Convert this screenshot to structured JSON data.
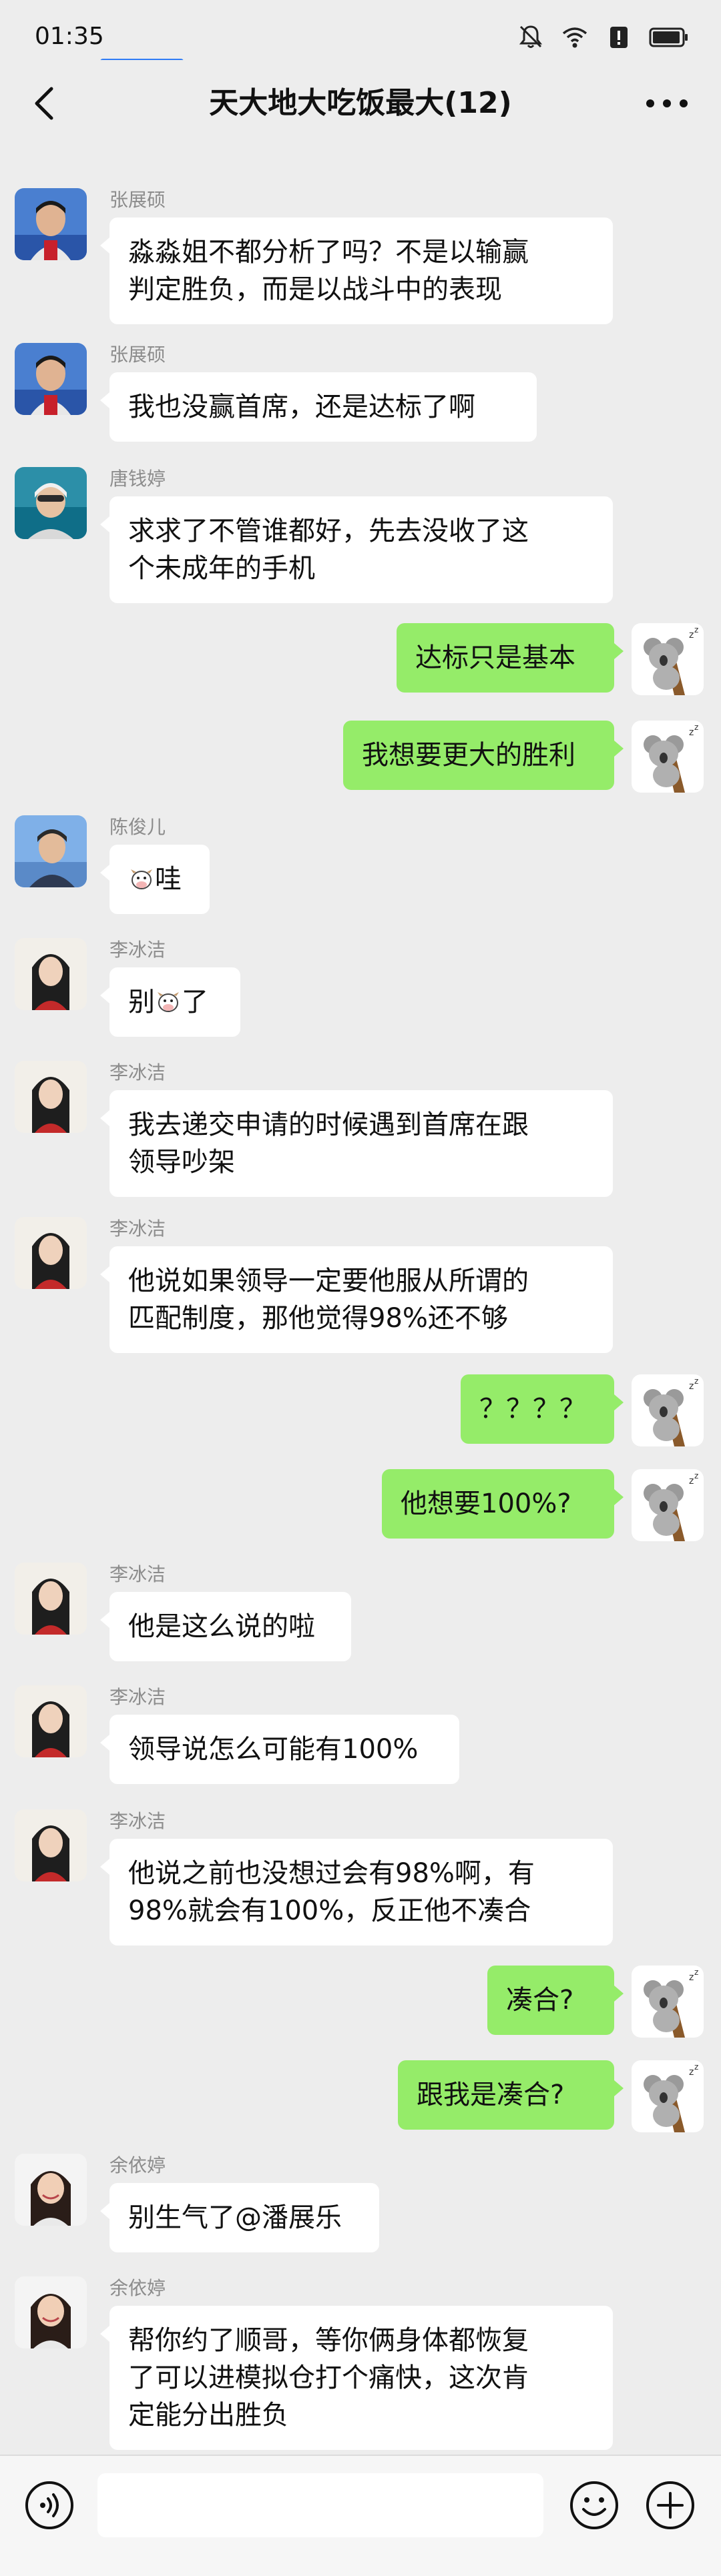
{
  "status_bar": {
    "time": "01:35",
    "icons": [
      "mute-bell-icon",
      "wifi-icon",
      "alert-icon",
      "battery-icon"
    ]
  },
  "header": {
    "title": "天大地大吃饭最大(12)",
    "back_icon": "chevron-left-icon",
    "more_icon": "more-dots-icon"
  },
  "colors": {
    "background": "#ededed",
    "self_bubble": "#95ec69",
    "other_bubble": "#ffffff",
    "sender_name": "#8c8c8c",
    "status_indicator": "#2f7cf6"
  },
  "messages": [
    {
      "side": "left",
      "sender": "张展硕",
      "avatar": "zhang-zhanshuo-avatar",
      "lines": [
        "淼淼姐不都分析了吗？不是以输赢",
        "判定胜负，而是以战斗中的表现"
      ]
    },
    {
      "side": "left",
      "sender": "张展硕",
      "avatar": "zhang-zhanshuo-avatar",
      "lines": [
        "我也没赢首席，还是达标了啊"
      ]
    },
    {
      "side": "left",
      "sender": "唐钱婷",
      "avatar": "tang-qianting-avatar",
      "lines": [
        "求求了不管谁都好，先去没收了这",
        "个未成年的手机"
      ]
    },
    {
      "side": "right",
      "avatar": "koala-avatar",
      "lines": [
        "达标只是基本"
      ]
    },
    {
      "side": "right",
      "avatar": "koala-avatar",
      "lines": [
        "我想要更大的胜利"
      ]
    },
    {
      "side": "left",
      "sender": "陈俊儿",
      "avatar": "chen-juner-avatar",
      "lines": [
        "哇"
      ],
      "cow_emoji": "prefix"
    },
    {
      "side": "left",
      "sender": "李冰洁",
      "avatar": "li-bingjie-avatar",
      "lines": [
        "别",
        "了"
      ],
      "cow_emoji": "middle"
    },
    {
      "side": "left",
      "sender": "李冰洁",
      "avatar": "li-bingjie-avatar",
      "lines": [
        "我去递交申请的时候遇到首席在跟",
        "领导吵架"
      ]
    },
    {
      "side": "left",
      "sender": "李冰洁",
      "avatar": "li-bingjie-avatar",
      "lines": [
        "他说如果领导一定要他服从所谓的",
        "匹配制度，那他觉得98%还不够"
      ]
    },
    {
      "side": "right",
      "avatar": "koala-avatar",
      "lines": [
        "？？？？"
      ]
    },
    {
      "side": "right",
      "avatar": "koala-avatar",
      "lines": [
        "他想要100%?"
      ]
    },
    {
      "side": "left",
      "sender": "李冰洁",
      "avatar": "li-bingjie-avatar",
      "lines": [
        "他是这么说的啦"
      ]
    },
    {
      "side": "left",
      "sender": "李冰洁",
      "avatar": "li-bingjie-avatar",
      "lines": [
        "领导说怎么可能有100%"
      ]
    },
    {
      "side": "left",
      "sender": "李冰洁",
      "avatar": "li-bingjie-avatar",
      "lines": [
        "他说之前也没想过会有98%啊，有",
        "98%就会有100%，反正他不凑合"
      ]
    },
    {
      "side": "right",
      "avatar": "koala-avatar",
      "lines": [
        "凑合?"
      ]
    },
    {
      "side": "right",
      "avatar": "koala-avatar",
      "lines": [
        "跟我是凑合?"
      ]
    },
    {
      "side": "left",
      "sender": "余依婷",
      "avatar": "yu-yiting-avatar",
      "lines": [
        "别生气了@潘展乐"
      ]
    },
    {
      "side": "left",
      "sender": "余依婷",
      "avatar": "yu-yiting-avatar",
      "lines": [
        "帮你约了顺哥，等你俩身体都恢复",
        "了可以进模拟仓打个痛快，这次肯",
        "定能分出胜负"
      ]
    }
  ],
  "input_bar": {
    "voice_icon": "voice-icon",
    "emoji_icon": "emoji-icon",
    "plus_icon": "plus-icon",
    "placeholder": ""
  }
}
